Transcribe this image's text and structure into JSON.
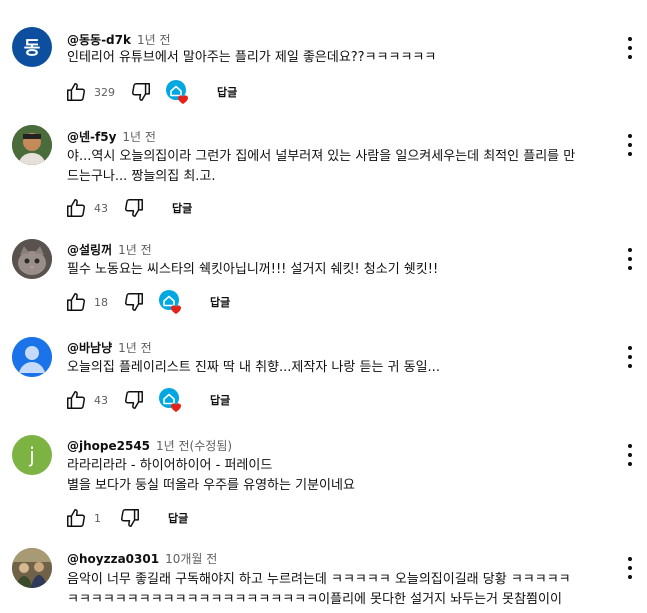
{
  "colors": {
    "accent": "#065fd4",
    "heart": "#e62117",
    "muted": "#606060"
  },
  "comments": [
    {
      "author": "@동동-d7k",
      "time": "1년 전",
      "avatar_letter": "동",
      "avatar_color": "#0d4f9e",
      "text": "인테리어 유튜브에서 말아주는 플리가 제일 좋은데요??ㅋㅋㅋㅋㅋㅋ",
      "likes": "329",
      "hearted": true,
      "reply_label": "답글",
      "icon": "creator-heart-icon"
    },
    {
      "author": "@넨-f5y",
      "time": "1년 전",
      "avatar_letter": "",
      "avatar_color": "#6b4a32",
      "text": "야...역시 오늘의집이라 그런가 집에서 널부러져 있는 사람을 일으켜세우는데 최적인 플리를 만\n드는구나... 짱늘의집 최.고.",
      "likes": "43",
      "hearted": false,
      "reply_label": "답글"
    },
    {
      "author": "@설링꺼",
      "time": "1년 전",
      "avatar_letter": "",
      "avatar_color": "#7a6f6a",
      "text": "필수 노동요는 씨스타의 쉑킷아닙니꺼!!! 설거지 쉐킷! 청소기 쉣킷!!",
      "likes": "18",
      "hearted": true,
      "reply_label": "답글"
    },
    {
      "author": "@바남냥",
      "time": "1년 전",
      "avatar_letter": "",
      "avatar_color": "#1a73e8",
      "text": "오늘의집 플레이리스트 진짜 딱 내 취향...제작자 나랑 듣는 귀 동일...",
      "likes": "43",
      "hearted": true,
      "reply_label": "답글"
    },
    {
      "author": "@jhope2545",
      "time": "1년 전(수정됨)",
      "avatar_letter": "j",
      "avatar_color": "#7cb342",
      "text": "라라리라라 - 하이어하이어 - 퍼레이드\n별을 보다가 둥실 떠올라 우주를 유영하는 기분이네요",
      "likes": "1",
      "hearted": false,
      "reply_label": "답글"
    },
    {
      "author": "@hoyzza0301",
      "time": "10개월 전",
      "avatar_letter": "",
      "avatar_color": "#8a7a55",
      "text": "음악이 너무 좋길래 구독해야지 하고 누르려는데 ㅋㅋㅋㅋㅋ 오늘의집이길래 당황 ㅋㅋㅋㅋㅋ\nㅋㅋㅋㅋㅋㅋㅋㅋㅋㅋㅋㅋㅋㅋㅋㅋㅋㅋㅋㅋㅋ이플리에 못다한 설거지 놔두는거 못참쬠이이",
      "likes": "",
      "hearted": false,
      "reply_label": ""
    }
  ]
}
